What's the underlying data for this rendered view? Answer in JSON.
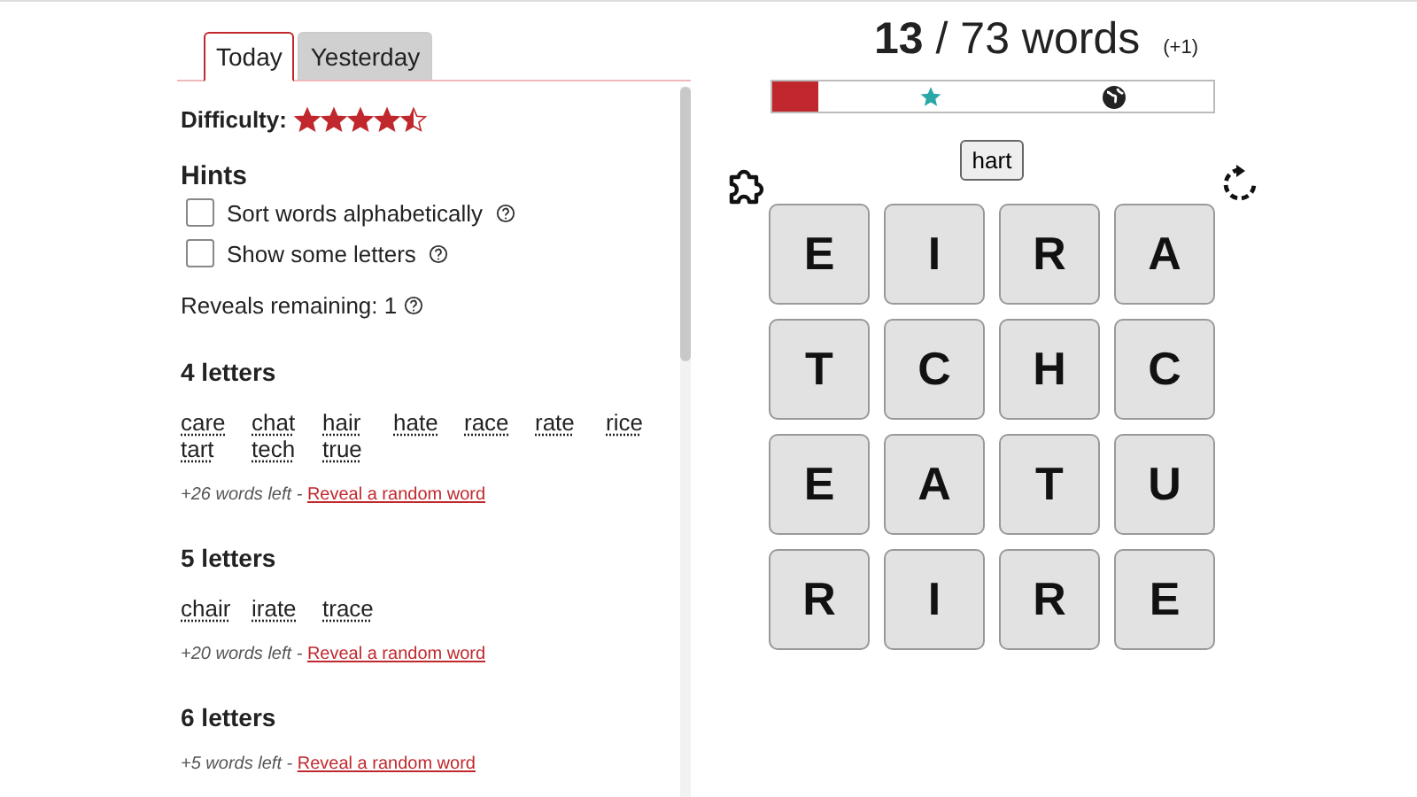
{
  "tabs": [
    {
      "label": "Today",
      "selected": true
    },
    {
      "label": "Yesterday",
      "selected": false
    }
  ],
  "difficulty": {
    "label": "Difficulty:",
    "stars": 4.5
  },
  "hints": {
    "title": "Hints",
    "options": [
      {
        "label": "Sort words alphabetically",
        "checked": false
      },
      {
        "label": "Show some letters",
        "checked": false
      }
    ],
    "reveals": "Reveals remaining: 1"
  },
  "groups": [
    {
      "title": "4 letters",
      "words": [
        "care",
        "chat",
        "hair",
        "hate",
        "race",
        "rate",
        "rice",
        "tart",
        "tech",
        "true"
      ],
      "left": "+26 words left -",
      "link": "Reveal a random word"
    },
    {
      "title": "5 letters",
      "words": [
        "chair",
        "irate",
        "trace"
      ],
      "left": "+20 words left -",
      "link": "Reveal a random word"
    },
    {
      "title": "6 letters",
      "left": "+5 words left -",
      "link": "Reveal a random word"
    }
  ],
  "score": {
    "text": "**13** / 73 words",
    "bonus": "(+1)"
  },
  "progress": {
    "level": 0.105
  },
  "current_word": "hart",
  "grid": [
    [
      "E",
      "I",
      "R",
      "A"
    ],
    [
      "T",
      "C",
      "H",
      "C"
    ],
    [
      "E",
      "A",
      "T",
      "U"
    ],
    [
      "R",
      "I",
      "R",
      "E"
    ]
  ]
}
